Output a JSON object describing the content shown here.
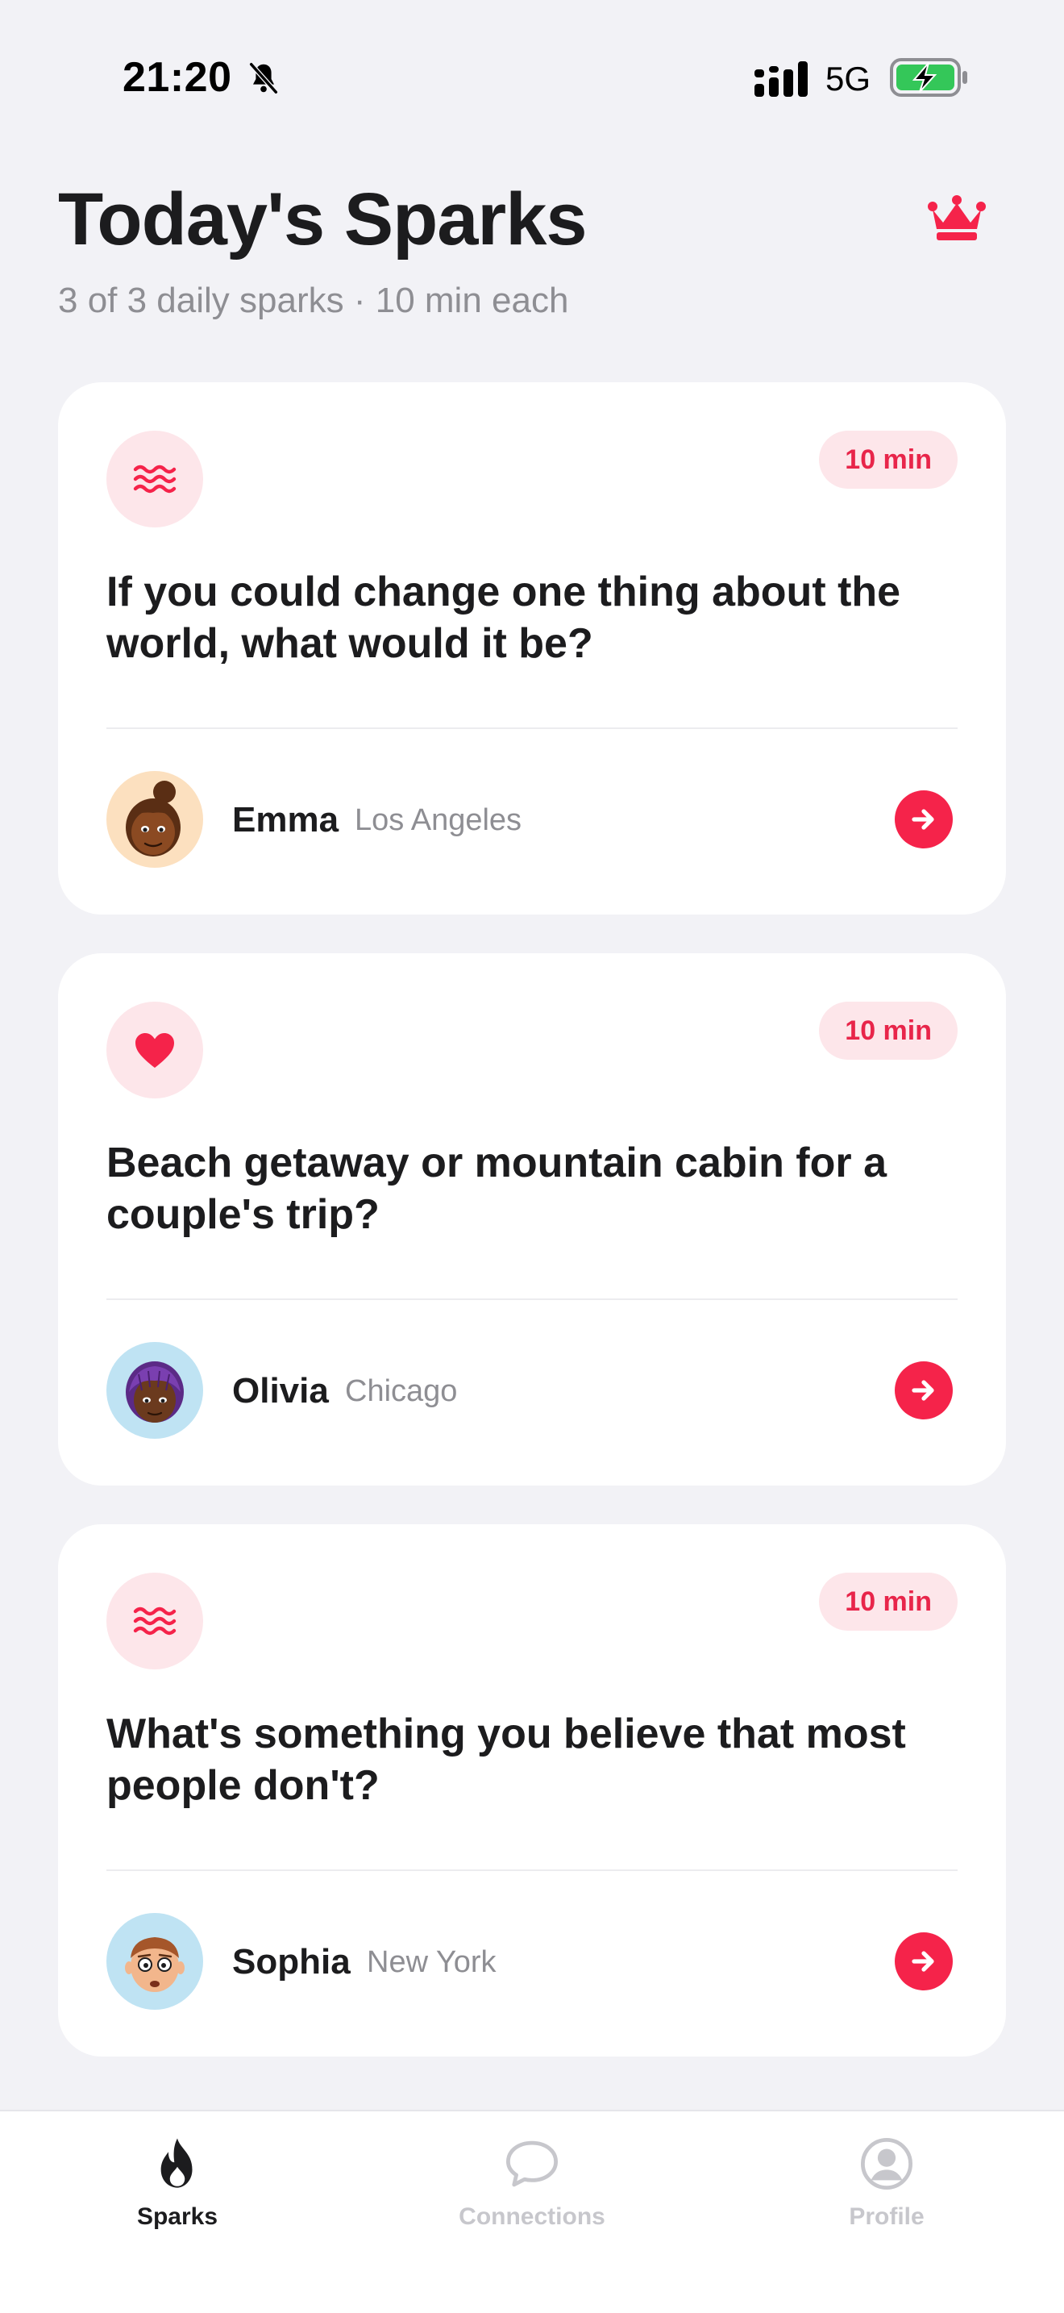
{
  "status_bar": {
    "time": "21:20",
    "network": "5G",
    "icons": [
      "bell-slash-icon",
      "signal-icon",
      "battery-charging-icon"
    ]
  },
  "header": {
    "title": "Today's Sparks",
    "subtitle": "3 of 3 daily sparks · 10 min each",
    "premium_icon": "crown-icon"
  },
  "sparks": [
    {
      "topic_icon": "waves-icon",
      "duration": "10 min",
      "question": "If you could change one thing about the world, what would it be?",
      "person": {
        "name": "Emma",
        "city": "Los Angeles"
      }
    },
    {
      "topic_icon": "heart-icon",
      "duration": "10 min",
      "question": "Beach getaway or mountain cabin for a couple's trip?",
      "person": {
        "name": "Olivia",
        "city": "Chicago"
      }
    },
    {
      "topic_icon": "waves-icon",
      "duration": "10 min",
      "question": "What's something you believe that most people don't?",
      "person": {
        "name": "Sophia",
        "city": "New York"
      }
    }
  ],
  "tab_bar": {
    "tabs": [
      {
        "label": "Sparks",
        "icon": "flame-icon",
        "active": true
      },
      {
        "label": "Connections",
        "icon": "chat-bubble-icon",
        "active": false
      },
      {
        "label": "Profile",
        "icon": "person-circle-icon",
        "active": false
      }
    ]
  },
  "colors": {
    "accent": "#F5234A",
    "accent_soft": "#FDE6EA",
    "background": "#F2F2F6",
    "card": "#FFFFFF",
    "secondary_text": "#8E8E93"
  }
}
